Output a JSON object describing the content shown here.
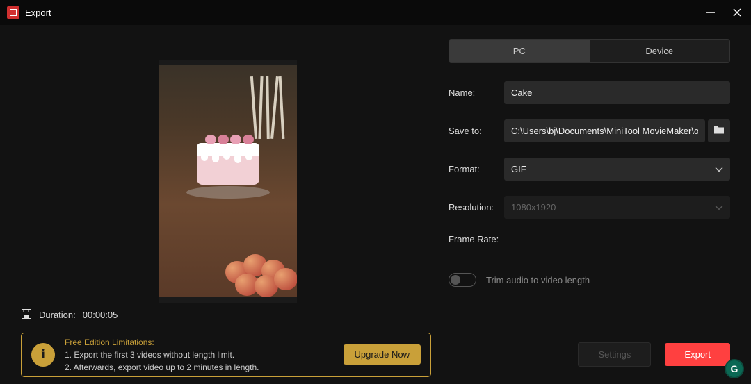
{
  "window": {
    "title": "Export"
  },
  "tabs": {
    "pc": "PC",
    "device": "Device"
  },
  "form": {
    "name_label": "Name:",
    "name_value": "Cake",
    "saveto_label": "Save to:",
    "saveto_value": "C:\\Users\\bj\\Documents\\MiniTool MovieMaker\\outp",
    "format_label": "Format:",
    "format_value": "GIF",
    "resolution_label": "Resolution:",
    "resolution_value": "1080x1920",
    "framerate_label": "Frame Rate:",
    "trim_label": "Trim audio to video length"
  },
  "duration": {
    "label": "Duration:",
    "value": "00:00:05"
  },
  "upgrade": {
    "title": "Free Edition Limitations:",
    "line1": "1. Export the first 3 videos without length limit.",
    "line2": "2. Afterwards, export video up to 2 minutes in length.",
    "button": "Upgrade Now"
  },
  "buttons": {
    "settings": "Settings",
    "export": "Export"
  },
  "colors": {
    "accent_red": "#ff4040",
    "accent_gold": "#c9a039",
    "bg": "#121212",
    "input_bg": "#2a2a2a"
  }
}
